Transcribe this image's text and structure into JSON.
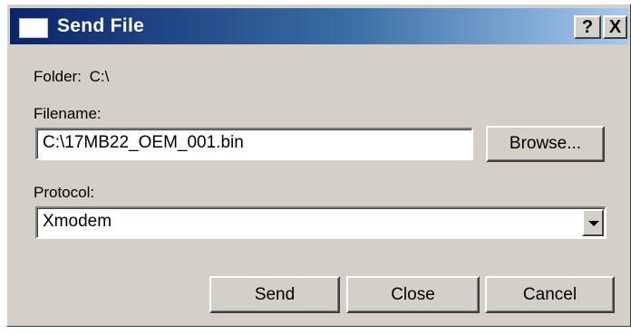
{
  "window": {
    "title": "Send File",
    "help_label": "?",
    "close_label": "X"
  },
  "folder": {
    "label": "Folder:",
    "value": "C:\\"
  },
  "filename": {
    "label": "Filename:",
    "value": "C:\\17MB22_OEM_001.bin",
    "browse_label": "Browse..."
  },
  "protocol": {
    "label": "Protocol:",
    "selected": "Xmodem"
  },
  "actions": {
    "send_label": "Send",
    "close_label": "Close",
    "cancel_label": "Cancel"
  }
}
